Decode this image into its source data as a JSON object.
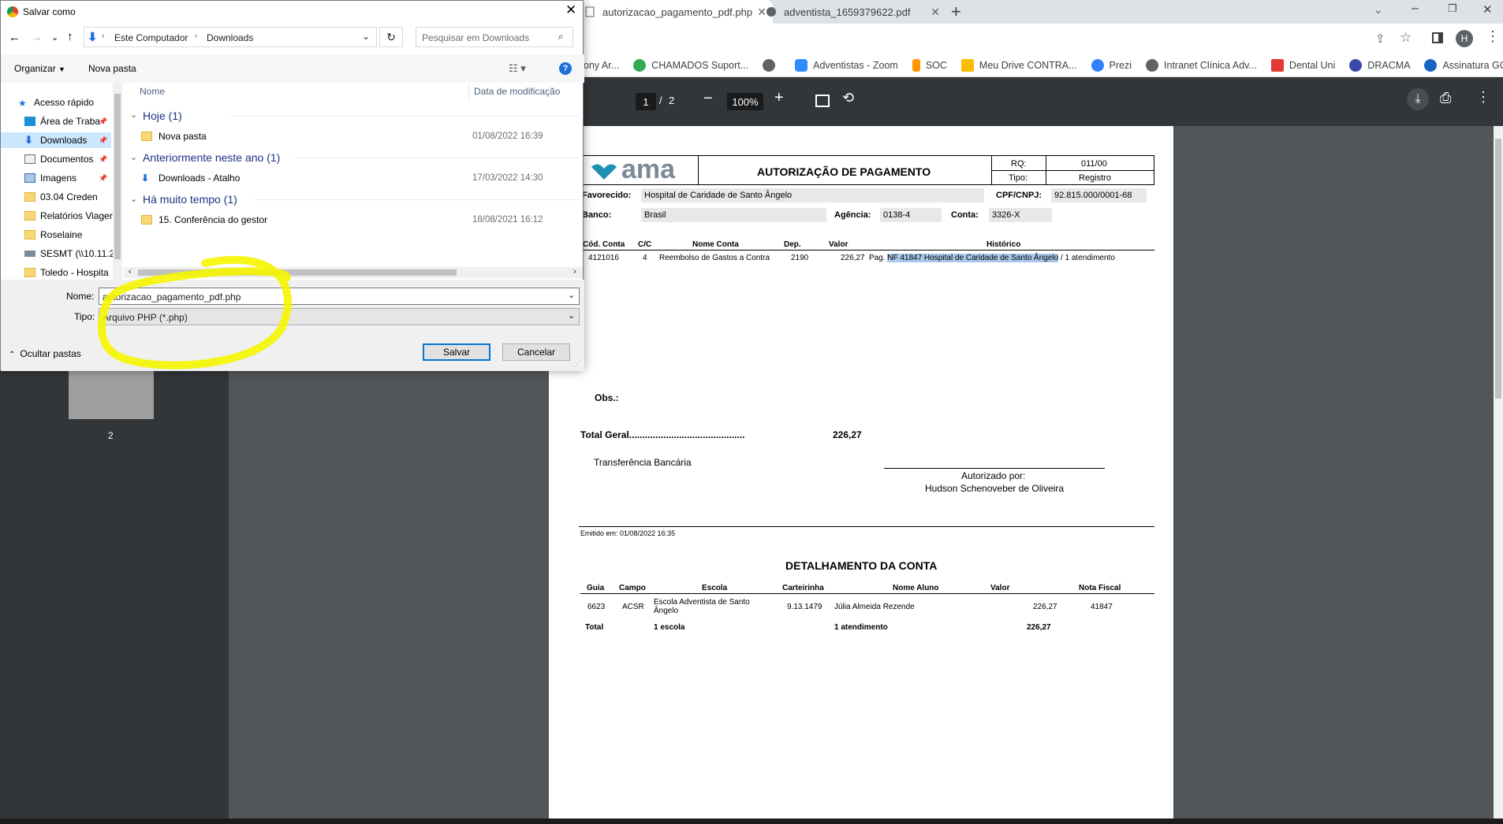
{
  "browser": {
    "tabs": [
      {
        "title": "autorizacao_pagamento_pdf.php",
        "active": true
      },
      {
        "title": "adventista_1659379622.pdf",
        "active": false
      }
    ],
    "new_tab": "+",
    "profile_initial": "H",
    "bookmarks": [
      {
        "label": "ony Ar...",
        "color": "#7e57c2"
      },
      {
        "label": "CHAMADOS Suport...",
        "color": "#34a853"
      },
      {
        "label": "Adventistas - Zoom",
        "color": "#2d8cff"
      },
      {
        "label": "SOC",
        "color": "#ff9800"
      },
      {
        "label": "Meu Drive CONTRA...",
        "color": "#fbbc04"
      },
      {
        "label": "Prezi",
        "color": "#3181ff"
      },
      {
        "label": "Intranet Clínica Adv...",
        "color": "#5f6368"
      },
      {
        "label": "Dental Uni",
        "color": "#e53935"
      },
      {
        "label": "DRACMA",
        "color": "#3949ab"
      },
      {
        "label": "Assinatura GOV",
        "color": "#1565c0"
      }
    ]
  },
  "pdf_toolbar": {
    "page_current": "1",
    "page_sep": "/",
    "page_total": "2",
    "zoom": "100%"
  },
  "thumbnail": {
    "page_label": "2"
  },
  "document": {
    "logo_text": "ama",
    "title": "AUTORIZAÇÃO DE PAGAMENTO",
    "rq_label": "RQ:",
    "rq_value": "011/00",
    "tipo_label": "Tipo:",
    "tipo_value": "Registro",
    "favorecido_label": "Favorecido:",
    "favorecido_value": "Hospital de Caridade de Santo Ângelo",
    "cpf_label": "CPF/CNPJ:",
    "cpf_value": "92.815.000/0001-68",
    "banco_label": "Banco:",
    "banco_value": "Brasil",
    "agencia_label": "Agência:",
    "agencia_value": "0138-4",
    "conta_label": "Conta:",
    "conta_value": "3326-X",
    "table_headers": [
      "Cód. Conta",
      "C/C",
      "Nome Conta",
      "Dep.",
      "Valor",
      "Histórico"
    ],
    "table_row": [
      "4121016",
      "4",
      "Reembolso de Gastos a Contra",
      "2190",
      "226,27"
    ],
    "historico_prefix": "Pag.",
    "historico_highlight": "NF 41847 Hospital de Caridade de Santo Ângelo",
    "historico_suffix": "/ 1 atendimento",
    "obs_label": "Obs.:",
    "total_label": "Total Geral............................................",
    "total_value": "226,27",
    "payment_method": "Transferência Bancária",
    "authorized_label": "Autorizado por:",
    "authorized_name": "Hudson Schenoveber de Oliveira",
    "emitido": "Emitido em: 01/08/2022 16:35",
    "detail_title": "DETALHAMENTO DA CONTA",
    "detail_headers": [
      "Guia",
      "Campo",
      "Escola",
      "Carteirinha",
      "Nome Aluno",
      "Valor",
      "Nota Fiscal"
    ],
    "detail_row": {
      "guia": "6623",
      "campo": "ACSR",
      "escola_line1": "Escola Adventista de Santo",
      "escola_line2": "Ângelo",
      "carteirinha": "9.13.1479",
      "aluno": "Júlia Almeida Rezende",
      "valor": "226,27",
      "nf": "41847"
    },
    "detail_total": {
      "label": "Total",
      "escola": "1 escola",
      "aluno": "1 atendimento",
      "valor": "226,27"
    }
  },
  "dialog": {
    "title": "Salvar como",
    "breadcrumb": [
      "Este Computador",
      "Downloads"
    ],
    "search_placeholder": "Pesquisar em Downloads",
    "organize": "Organizar",
    "new_folder": "Nova pasta",
    "help": "?",
    "nav": [
      {
        "label": "Acesso rápido",
        "icon": "star"
      },
      {
        "label": "Área de Traba",
        "icon": "desktop"
      },
      {
        "label": "Downloads",
        "icon": "download"
      },
      {
        "label": "Documentos",
        "icon": "document"
      },
      {
        "label": "Imagens",
        "icon": "image"
      },
      {
        "label": "03.04 Creden",
        "icon": "folder"
      },
      {
        "label": "Relatórios Viager",
        "icon": "folder"
      },
      {
        "label": "Roselaine",
        "icon": "folder"
      },
      {
        "label": "SESMT (\\\\10.11.2",
        "icon": "network"
      },
      {
        "label": "Toledo - Hospita",
        "icon": "folder"
      }
    ],
    "col_name": "Nome",
    "col_date": "Data de modificação",
    "groups": [
      {
        "label": "Hoje (1)",
        "files": [
          {
            "name": "Nova pasta",
            "date": "01/08/2022 16:39",
            "icon": "folder"
          }
        ]
      },
      {
        "label": "Anteriormente neste ano (1)",
        "files": [
          {
            "name": "Downloads - Atalho",
            "date": "17/03/2022 14:30",
            "icon": "shortcut"
          }
        ]
      },
      {
        "label": "Há muito tempo (1)",
        "files": [
          {
            "name": "15. Conferência do gestor",
            "date": "18/08/2021 16:12",
            "icon": "folder"
          }
        ]
      }
    ],
    "name_label": "Nome:",
    "name_value": "autorizacao_pagamento_pdf.php",
    "type_label": "Tipo:",
    "type_value": "Arquivo PHP (*.php)",
    "save": "Salvar",
    "cancel": "Cancelar",
    "hide_folders": "Ocultar pastas"
  },
  "annotation_color": "#f5f500"
}
